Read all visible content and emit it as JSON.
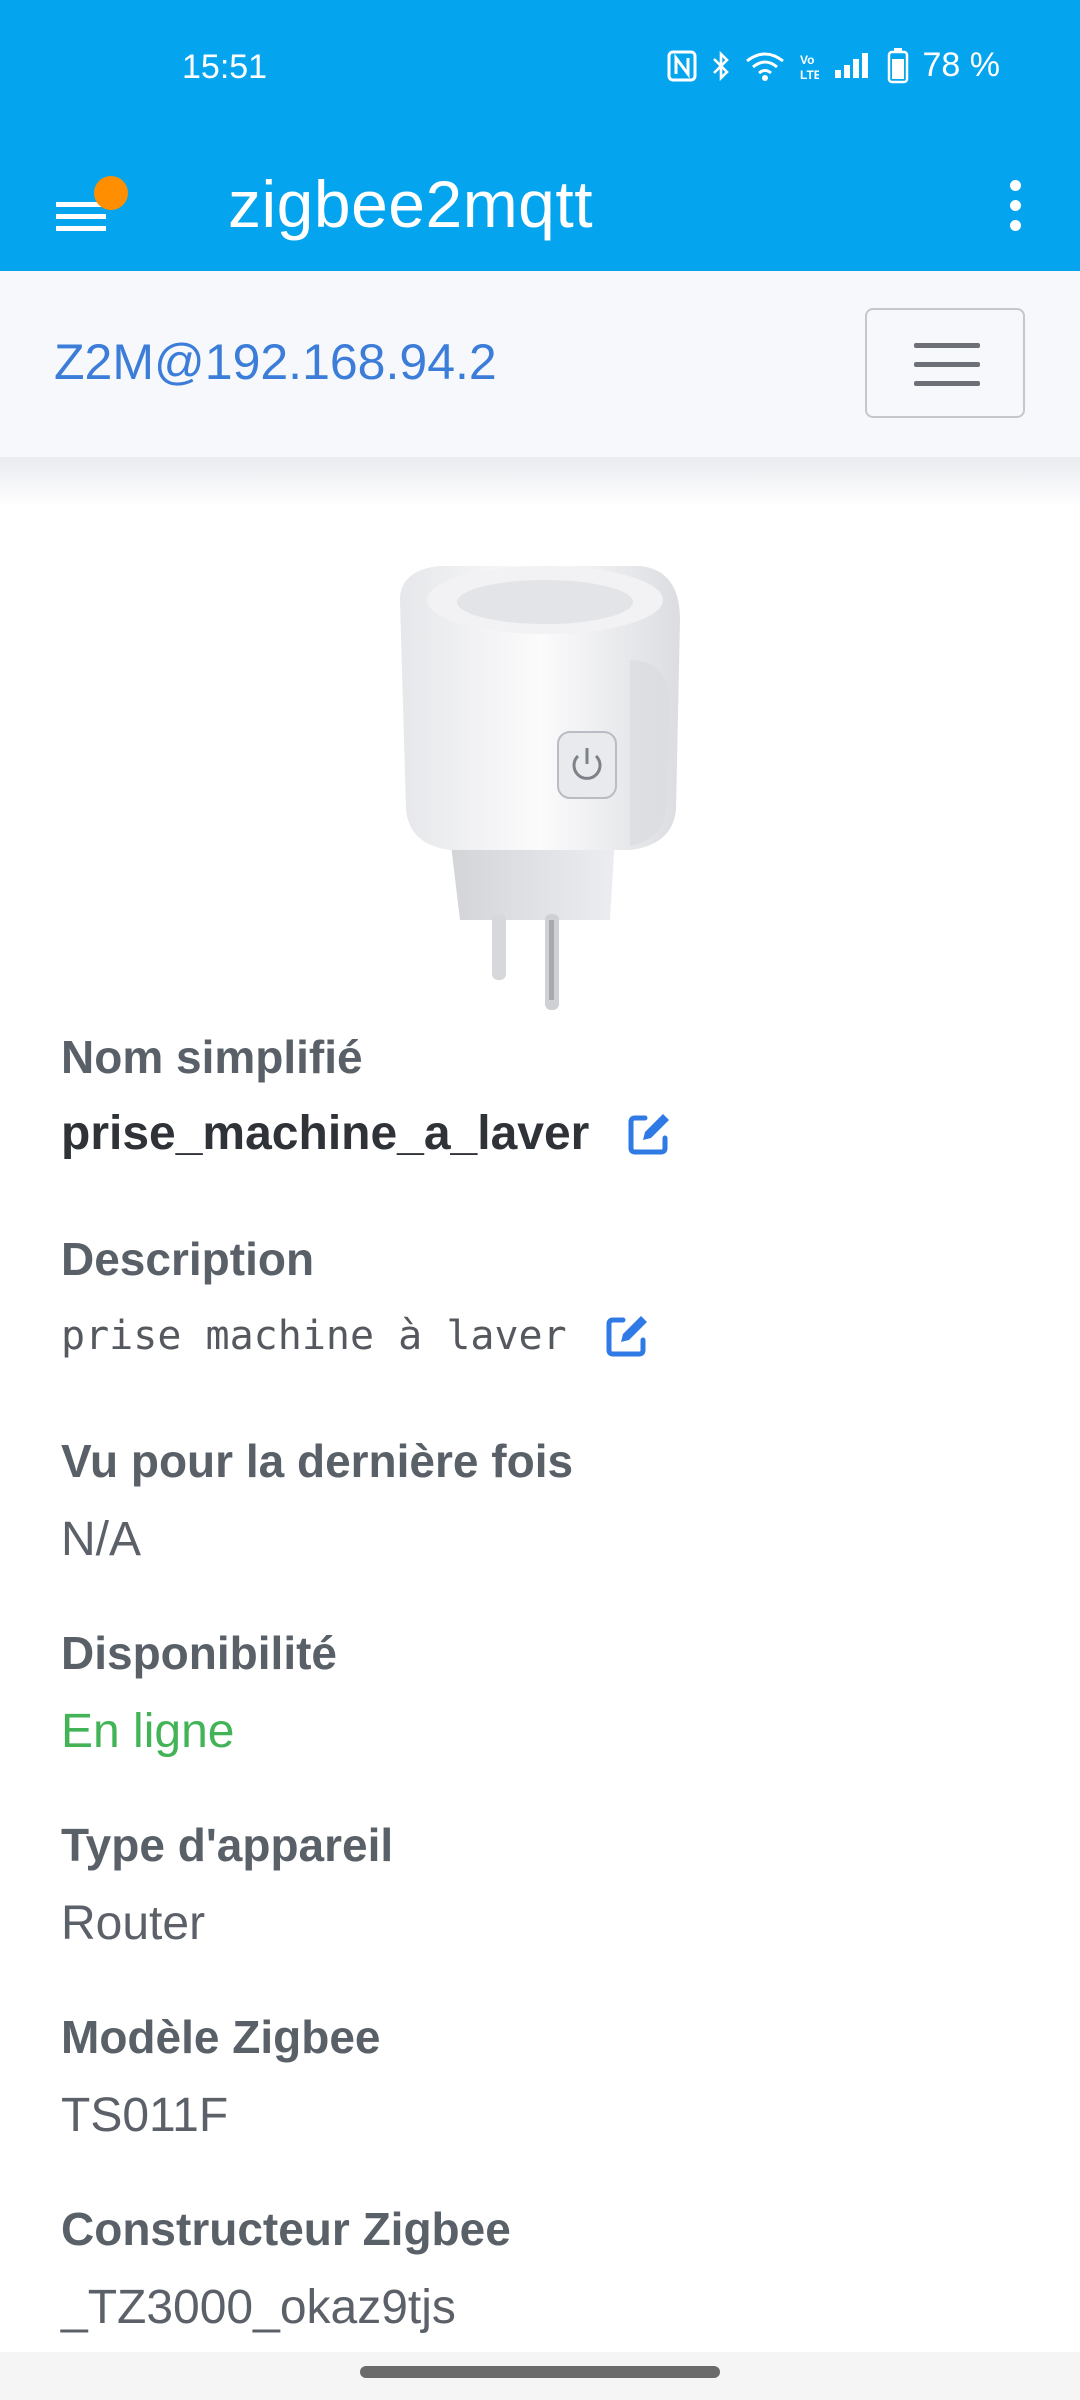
{
  "status_bar": {
    "time": "15:51",
    "battery": "78 %",
    "icons": [
      "nfc-icon",
      "bluetooth-icon",
      "wifi-icon",
      "volte-icon",
      "signal-icon",
      "battery-icon"
    ]
  },
  "app_bar": {
    "title": "zigbee2mqtt",
    "menu_icon": "menu-icon",
    "more_icon": "more-vert-icon"
  },
  "navbar": {
    "brand": "Z2M@192.168.94.2",
    "toggler_icon": "hamburger-icon"
  },
  "device": {
    "image": "smart-plug-image",
    "fields": [
      {
        "label": "Nom simplifié",
        "value": "prise_machine_a_laver",
        "editable": true
      },
      {
        "label": "Description",
        "value": "prise machine à laver",
        "editable": true
      },
      {
        "label": "Vu pour la dernière fois",
        "value": "N/A"
      },
      {
        "label": "Disponibilité",
        "value": "En ligne",
        "color": "#43b358"
      },
      {
        "label": "Type d'appareil",
        "value": "Router"
      },
      {
        "label": "Modèle Zigbee",
        "value": "TS011F"
      },
      {
        "label": "Constructeur Zigbee",
        "value": "_TZ3000_okaz9tjs"
      }
    ]
  },
  "colors": {
    "app_bar": "#04a4ee",
    "brand": "#3b7dd8",
    "accent_dot": "#ff8f00",
    "online": "#43b358"
  }
}
